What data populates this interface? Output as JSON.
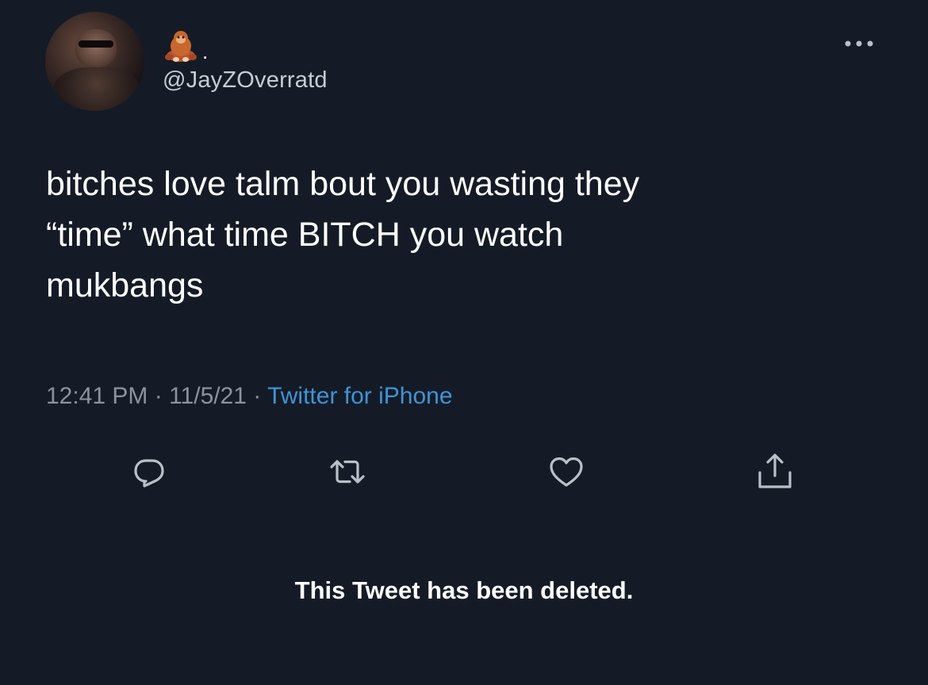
{
  "author": {
    "display_name_icon": "monkey-emoji-icon",
    "display_name_suffix": ".",
    "handle": "@JayZOverratd"
  },
  "tweet": {
    "text": "bitches love talm bout you wasting they\n“time” what time BITCH you watch\nmukbangs",
    "time": "12:41 PM",
    "separator": " · ",
    "date": "11/5/21",
    "source": "Twitter for iPhone"
  },
  "actions": {
    "reply_icon": "reply-icon",
    "retweet_icon": "retweet-icon",
    "like_icon": "heart-icon",
    "share_icon": "share-icon"
  },
  "notice": {
    "text": "This Tweet has been deleted."
  },
  "colors": {
    "background": "#151b26",
    "primary_text": "#ffffff",
    "secondary_text": "#8a939d",
    "link": "#3f93d6",
    "icon": "#b9c0c8"
  }
}
